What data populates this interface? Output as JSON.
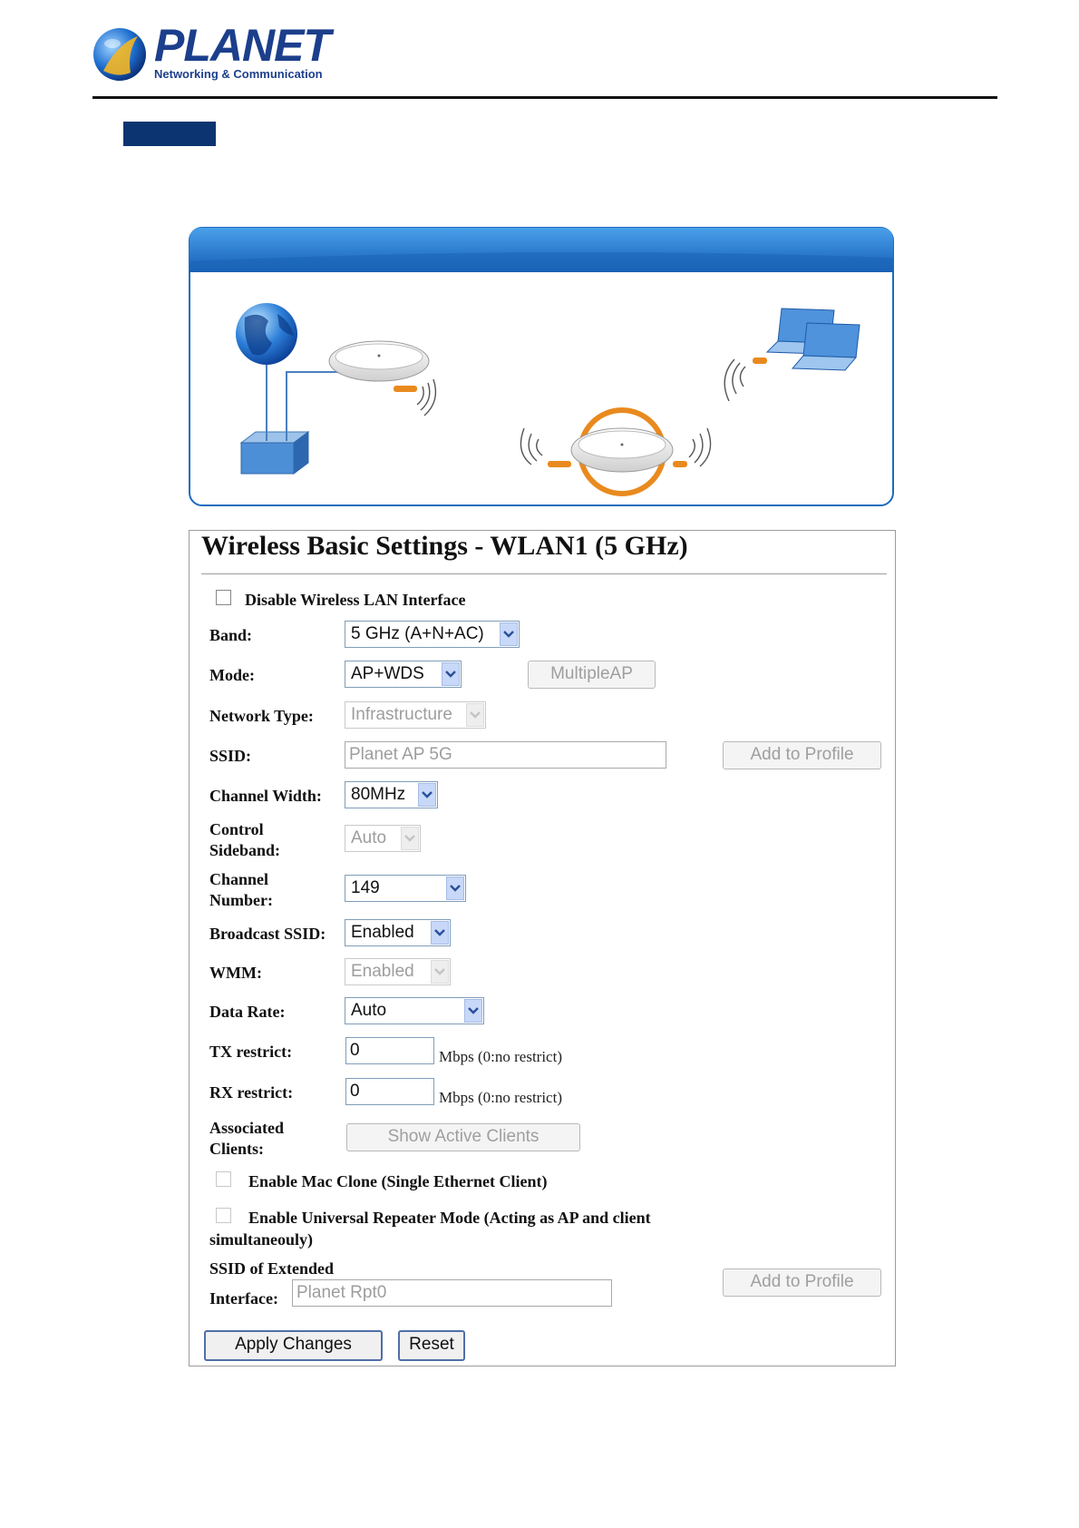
{
  "brand": {
    "name": "PLANET",
    "tagline": "Networking & Communication"
  },
  "form": {
    "title": "Wireless Basic Settings - WLAN1 (5 GHz)",
    "disable_wlan_label": "Disable Wireless LAN Interface",
    "band": {
      "label": "Band:",
      "value": "5 GHz (A+N+AC)"
    },
    "mode": {
      "label": "Mode:",
      "value": "AP+WDS",
      "multiple_ap": "MultipleAP"
    },
    "network_type": {
      "label": "Network Type:",
      "value": "Infrastructure"
    },
    "ssid": {
      "label": "SSID:",
      "value": "Planet AP 5G",
      "add_profile": "Add to Profile"
    },
    "channel_width": {
      "label": "Channel Width:",
      "value": "80MHz"
    },
    "control_sideband": {
      "label_line1": "Control",
      "label_line2": "Sideband:",
      "value": "Auto"
    },
    "channel_number": {
      "label_line1": "Channel",
      "label_line2": "Number:",
      "value": "149"
    },
    "broadcast_ssid": {
      "label": "Broadcast SSID:",
      "value": "Enabled"
    },
    "wmm": {
      "label": "WMM:",
      "value": "Enabled"
    },
    "data_rate": {
      "label": "Data Rate:",
      "value": "Auto"
    },
    "tx_restrict": {
      "label": "TX restrict:",
      "value": "0",
      "unit": "Mbps (0:no restrict)"
    },
    "rx_restrict": {
      "label": "RX restrict:",
      "value": "0",
      "unit": "Mbps (0:no restrict)"
    },
    "associated_clients": {
      "label_line1": "Associated",
      "label_line2": "Clients:",
      "button": "Show Active Clients"
    },
    "mac_clone_label": "Enable Mac Clone (Single Ethernet Client)",
    "universal_repeater_line1": "Enable Universal Repeater Mode (Acting as AP and client",
    "universal_repeater_line2": "simultaneouly)",
    "ssid_extended": {
      "label_line1": "SSID of Extended",
      "label_line2": "Interface:",
      "value": "Planet Rpt0",
      "add_profile": "Add to Profile"
    },
    "apply_button": "Apply Changes",
    "reset_button": "Reset"
  },
  "colors": {
    "brand_blue": "#1c3f8c",
    "section_bar": "#0b3470",
    "diagram_header": "#1d6cc0",
    "accent_orange": "#e88a1e"
  }
}
